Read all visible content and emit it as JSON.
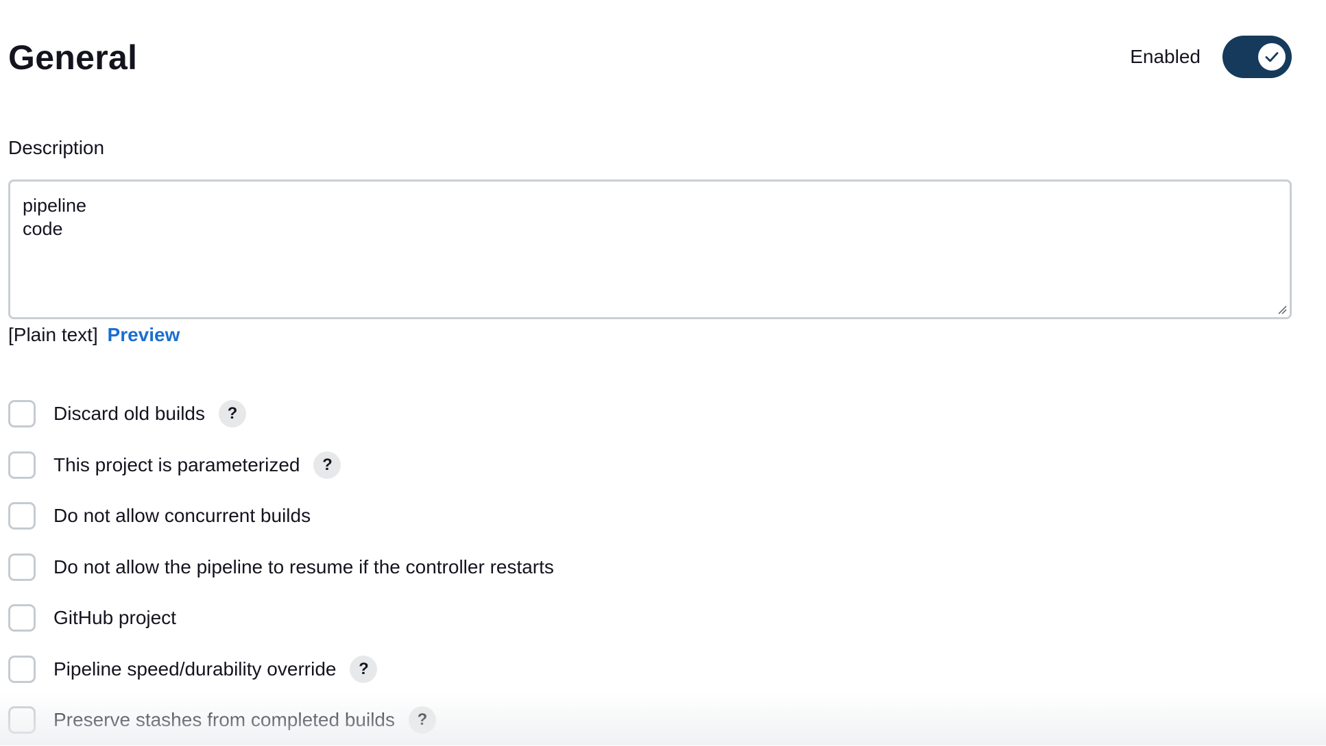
{
  "section": {
    "title": "General"
  },
  "enabled_toggle": {
    "label": "Enabled",
    "state": true,
    "color": "#153a5c"
  },
  "description": {
    "label": "Description",
    "value": "pipeline\ncode",
    "format_label": "[Plain text]",
    "preview_link": "Preview",
    "link_color": "#1b6ed1"
  },
  "options": [
    {
      "label": "Discard old builds",
      "checked": false,
      "help": "?"
    },
    {
      "label": "This project is parameterized",
      "checked": false,
      "help": "?"
    },
    {
      "label": "Do not allow concurrent builds",
      "checked": false
    },
    {
      "label": "Do not allow the pipeline to resume if the controller restarts",
      "checked": false
    },
    {
      "label": "GitHub project",
      "checked": false
    },
    {
      "label": "Pipeline speed/durability override",
      "checked": false,
      "help": "?"
    },
    {
      "label": "Preserve stashes from completed builds",
      "checked": false,
      "help": "?"
    }
  ],
  "icons": {
    "toggle_check": "check-icon",
    "help": "help-icon",
    "resize": "resize-grip-icon"
  }
}
